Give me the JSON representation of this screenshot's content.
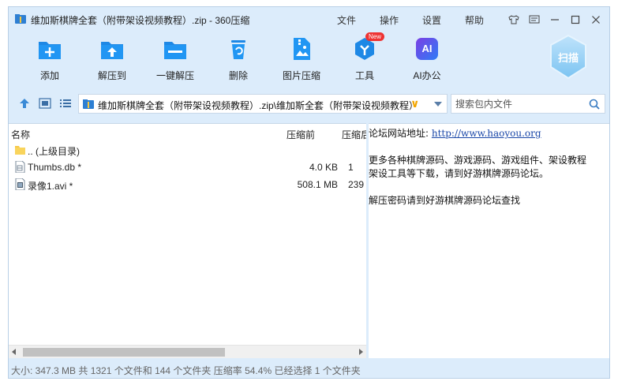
{
  "window": {
    "title": "维加斯棋牌全套（附带架设视频教程）.zip - 360压缩"
  },
  "menu": [
    "文件",
    "操作",
    "设置",
    "帮助"
  ],
  "toolbar": {
    "tools": [
      {
        "label": "添加",
        "icon": "add-file-icon"
      },
      {
        "label": "解压到",
        "icon": "extract-to-icon"
      },
      {
        "label": "一键解压",
        "icon": "one-click-extract-icon"
      },
      {
        "label": "删除",
        "icon": "delete-icon"
      },
      {
        "label": "图片压缩",
        "icon": "image-compress-icon"
      },
      {
        "label": "工具",
        "icon": "tools-icon",
        "badge": "New"
      },
      {
        "label": "AI办公",
        "icon": "ai-office-icon",
        "glyph": "AI"
      }
    ],
    "scan_label": "扫描"
  },
  "address": {
    "path": "维加斯棋牌全套（附带架设视频教程）.zip\\维加斯全套（附带架设视频教程）",
    "search_placeholder": "搜索包内文件"
  },
  "file_list": {
    "columns": {
      "name": "名称",
      "size": "压缩前",
      "packed": "压缩后"
    },
    "rows": [
      {
        "name": ".. (上级目录)",
        "size": "",
        "packed": "",
        "icon": "folder-icon"
      },
      {
        "name": "Thumbs.db *",
        "size": "4.0 KB",
        "packed": "1",
        "icon": "db-file-icon"
      },
      {
        "name": "录像1.avi *",
        "size": "508.1 MB",
        "packed": "239",
        "icon": "video-file-icon"
      }
    ]
  },
  "comment": {
    "forum_label": "论坛网站地址:",
    "forum_url": "http://www.haoyou.org",
    "line2": "更多各种棋牌源码、游戏源码、游戏组件、架设教程",
    "line3": "架设工具等下载，请到好游棋牌源码论坛。",
    "line4": "解压密码请到好游棋牌源码论坛查找"
  },
  "status": {
    "text": "大小: 347.3 MB 共 1321 个文件和 144 个文件夹 压缩率 54.4% 已经选择 1 个文件夹"
  },
  "colors": {
    "window_bg": "#dcecfb",
    "accent_blue": "#1e88e5",
    "link": "#1a47a8"
  }
}
